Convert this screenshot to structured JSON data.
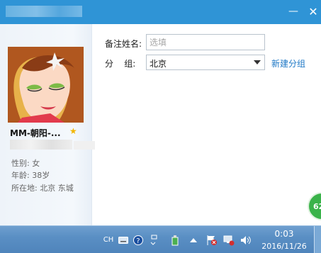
{
  "window": {
    "minimize_glyph": "—",
    "close_glyph": "✕"
  },
  "profile": {
    "name": "MM-朝阳-...",
    "favorite_icon": "star-icon",
    "sex": "性别: 女",
    "age": "年龄: 38岁",
    "location": "所在地: 北京  东城"
  },
  "form": {
    "remark_label": "备注姓名:",
    "remark_placeholder": "选填",
    "remark_value": "",
    "group_label": "分    组:",
    "group_value": "北京",
    "new_group_link": "新建分组"
  },
  "badge": {
    "text": "62"
  },
  "taskbar": {
    "input_method": "CH",
    "time": "0:03",
    "date": "2016/11/26",
    "icons": [
      "keyboard-icon",
      "help-icon",
      "options-icon",
      "usb-icon",
      "show-hidden-icon",
      "action-center-flag-icon",
      "network-icon",
      "volume-icon"
    ]
  },
  "colors": {
    "titlebar": "#2f94d6",
    "link": "#1e78c6",
    "star": "#f2b600",
    "badge": "#3ab34a"
  }
}
